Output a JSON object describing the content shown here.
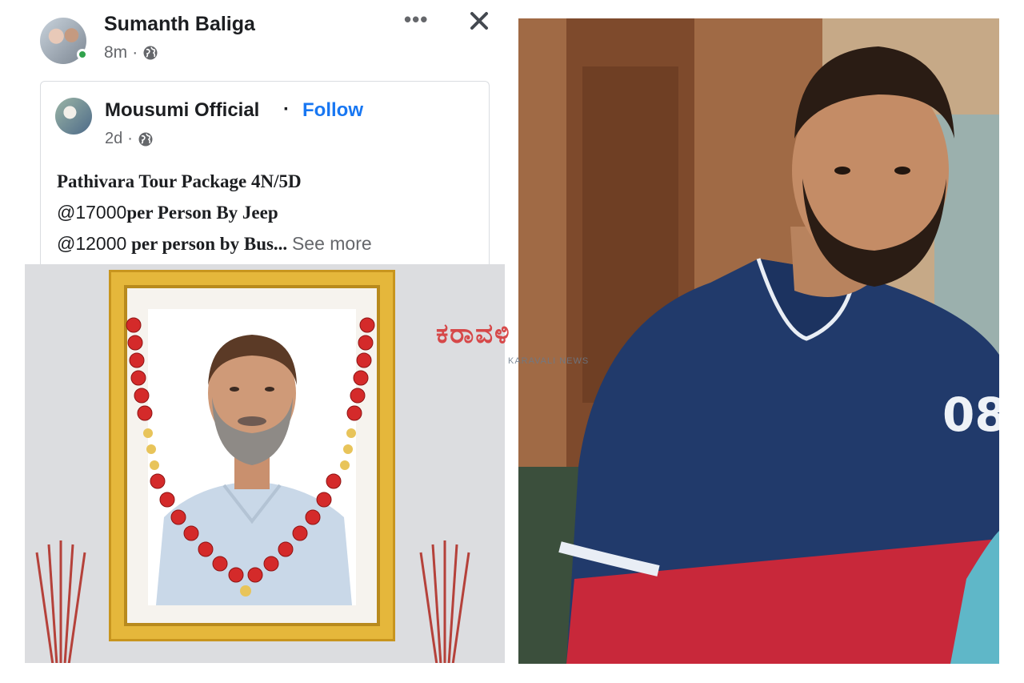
{
  "post": {
    "author": "Sumanth Baliga",
    "time": "8m",
    "shared": {
      "page_name": "Mousumi Official",
      "separator": "·",
      "follow_label": "Follow",
      "time": "2d",
      "lines": [
        {
          "prefix": "",
          "text": "Pathivara Tour Package 4N/5D"
        },
        {
          "prefix": "@17000",
          "text": "per Person By Jeep"
        },
        {
          "prefix": "@12000",
          "text": " per person by Bus..."
        }
      ],
      "see_more": "See more"
    },
    "meta_separator": "·"
  },
  "watermark": {
    "main": "ಕರಾವಳಿ",
    "sub": "KARAVALI NEWS"
  },
  "photo_shirt_number": "08",
  "colors": {
    "follow": "#1877f2",
    "online": "#31a24c",
    "frame_gold": "#e5b73b",
    "garland_red": "#d42a2a",
    "shirt_navy": "#213a6b",
    "shirt_red": "#c8283a"
  },
  "icons": [
    "globe-icon",
    "more-options-icon",
    "close-icon"
  ]
}
